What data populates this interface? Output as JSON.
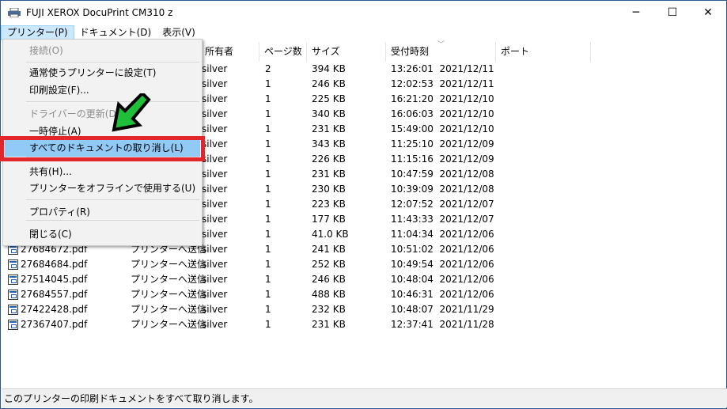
{
  "window": {
    "title": "FUJI XEROX DocuPrint CM310 z",
    "minimize": "─",
    "maximize": "☐",
    "close": "✕"
  },
  "menubar": [
    "プリンター(P)",
    "ドキュメント(D)",
    "表示(V)"
  ],
  "columns": [
    "所有者",
    "ページ数",
    "サイズ",
    "受付時刻",
    "ポート"
  ],
  "rows": [
    {
      "name": "",
      "status": "",
      "owner": "silver",
      "pages": "2",
      "size": "394 KB",
      "time": "13:26:01  2021/12/11"
    },
    {
      "name": "",
      "status": "",
      "owner": "silver",
      "pages": "1",
      "size": "246 KB",
      "time": "12:02:53  2021/12/11"
    },
    {
      "name": "",
      "status": "",
      "owner": "silver",
      "pages": "1",
      "size": "225 KB",
      "time": "16:21:20  2021/12/10"
    },
    {
      "name": "",
      "status": "",
      "owner": "silver",
      "pages": "1",
      "size": "340 KB",
      "time": "16:06:03  2021/12/10"
    },
    {
      "name": "",
      "status": "",
      "owner": "silver",
      "pages": "1",
      "size": "231 KB",
      "time": "15:49:00  2021/12/10"
    },
    {
      "name": "",
      "status": "",
      "owner": "silver",
      "pages": "1",
      "size": "343 KB",
      "time": "11:25:10  2021/12/09"
    },
    {
      "name": "",
      "status": "",
      "owner": "silver",
      "pages": "1",
      "size": "226 KB",
      "time": "11:15:16  2021/12/09"
    },
    {
      "name": "",
      "status": "",
      "owner": "silver",
      "pages": "1",
      "size": "231 KB",
      "time": "10:47:59  2021/12/08"
    },
    {
      "name": "",
      "status": "",
      "owner": "silver",
      "pages": "1",
      "size": "230 KB",
      "time": "10:39:09  2021/12/08"
    },
    {
      "name": "",
      "status": "",
      "owner": "silver",
      "pages": "1",
      "size": "223 KB",
      "time": "12:07:52  2021/12/07"
    },
    {
      "name": "",
      "status": "",
      "owner": "silver",
      "pages": "1",
      "size": "177 KB",
      "time": "11:43:33  2021/12/07"
    },
    {
      "name": "",
      "status": "",
      "owner": "silver",
      "pages": "1",
      "size": "41.0 KB",
      "time": "11:04:34  2021/12/06"
    },
    {
      "name": "27684672.pdf",
      "status": "プリンターへ送信",
      "owner": "silver",
      "pages": "1",
      "size": "241 KB",
      "time": "10:51:02  2021/12/06"
    },
    {
      "name": "27684684.pdf",
      "status": "プリンターへ送信",
      "owner": "silver",
      "pages": "1",
      "size": "252 KB",
      "time": "10:49:54  2021/12/06"
    },
    {
      "name": "27514045.pdf",
      "status": "プリンターへ送信",
      "owner": "silver",
      "pages": "1",
      "size": "246 KB",
      "time": "10:48:04  2021/12/06"
    },
    {
      "name": "27684557.pdf",
      "status": "プリンターへ送信",
      "owner": "silver",
      "pages": "1",
      "size": "488 KB",
      "time": "10:46:31  2021/12/06"
    },
    {
      "name": "27422428.pdf",
      "status": "プリンターへ送信",
      "owner": "silver",
      "pages": "1",
      "size": "232 KB",
      "time": "10:48:07  2021/11/29"
    },
    {
      "name": "27367407.pdf",
      "status": "プリンターへ送信",
      "owner": "silver",
      "pages": "1",
      "size": "231 KB",
      "time": "12:37:41  2021/11/28"
    }
  ],
  "menu": [
    {
      "label": "接続(O)",
      "disabled": true
    },
    {
      "sep": true
    },
    {
      "label": "通常使うプリンターに設定(T)"
    },
    {
      "label": "印刷設定(F)..."
    },
    {
      "sep": true
    },
    {
      "label": "ドライバーの更新(D)",
      "disabled": true
    },
    {
      "label": "一時停止(A)"
    },
    {
      "label": "すべてのドキュメントの取り消し(L)",
      "highlighted": true
    },
    {
      "sep": true
    },
    {
      "label": "共有(H)..."
    },
    {
      "label": "プリンターをオフラインで使用する(U)"
    },
    {
      "sep": true
    },
    {
      "label": "プロパティ(R)"
    },
    {
      "sep": true
    },
    {
      "label": "閉じる(C)"
    }
  ],
  "statusbar": "このプリンターの印刷ドキュメントをすべて取り消します。",
  "colors": {
    "highlight": "#91c9f7",
    "annotation_box": "#e3262b",
    "annotation_arrow": "#1fbf3a"
  }
}
